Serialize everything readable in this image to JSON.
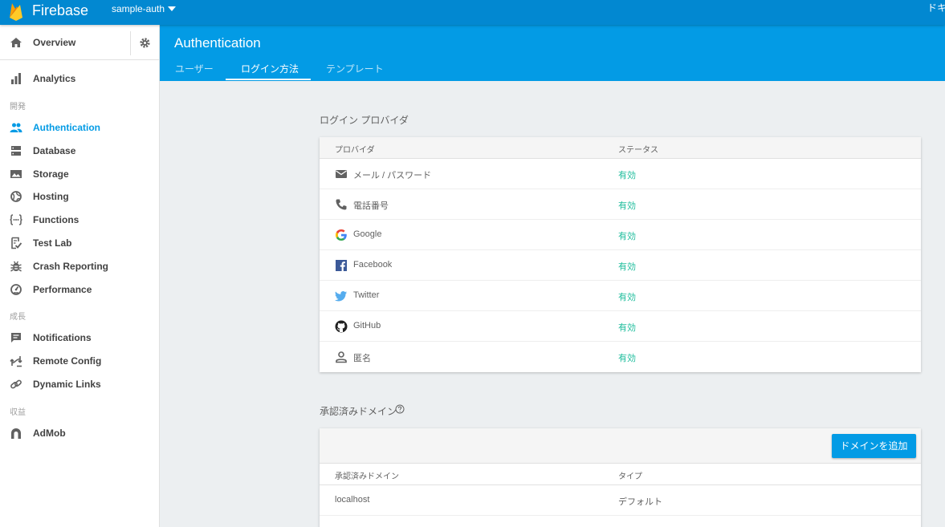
{
  "topbar": {
    "brand": "Firebase",
    "project": "sample-auth",
    "right_text": "ドキ"
  },
  "sidebar": {
    "overview": "Overview",
    "analytics": "Analytics",
    "section_develop": "開発",
    "develop_items": [
      {
        "label": "Authentication",
        "icon": "people-icon"
      },
      {
        "label": "Database",
        "icon": "database-icon"
      },
      {
        "label": "Storage",
        "icon": "image-icon"
      },
      {
        "label": "Hosting",
        "icon": "globe-icon"
      },
      {
        "label": "Functions",
        "icon": "functions-icon"
      },
      {
        "label": "Test Lab",
        "icon": "checklist-icon"
      },
      {
        "label": "Crash Reporting",
        "icon": "bug-icon"
      },
      {
        "label": "Performance",
        "icon": "gauge-icon"
      }
    ],
    "section_grow": "成長",
    "grow_items": [
      {
        "label": "Notifications",
        "icon": "message-icon"
      },
      {
        "label": "Remote Config",
        "icon": "remote-config-icon"
      },
      {
        "label": "Dynamic Links",
        "icon": "link-icon"
      }
    ],
    "section_earn": "収益",
    "earn_items": [
      {
        "label": "AdMob",
        "icon": "admob-icon"
      }
    ]
  },
  "header": {
    "title": "Authentication",
    "tabs": [
      "ユーザー",
      "ログイン方法",
      "テンプレート"
    ],
    "active_tab": 1
  },
  "providers": {
    "section_title": "ログイン プロバイダ",
    "col_provider": "プロバイダ",
    "col_status": "ステータス",
    "rows": [
      {
        "name": "メール / パスワード",
        "status": "有効",
        "icon": "mail-icon"
      },
      {
        "name": "電話番号",
        "status": "有効",
        "icon": "phone-icon"
      },
      {
        "name": "Google",
        "status": "有効",
        "icon": "google-icon"
      },
      {
        "name": "Facebook",
        "status": "有効",
        "icon": "facebook-icon"
      },
      {
        "name": "Twitter",
        "status": "有効",
        "icon": "twitter-icon"
      },
      {
        "name": "GitHub",
        "status": "有効",
        "icon": "github-icon"
      },
      {
        "name": "匿名",
        "status": "有効",
        "icon": "person-icon"
      }
    ]
  },
  "domains": {
    "section_title": "承認済みドメイン",
    "add_button": "ドメインを追加",
    "col_domain": "承認済みドメイン",
    "col_type": "タイプ",
    "rows": [
      {
        "domain": "localhost",
        "type": "デフォルト"
      }
    ]
  },
  "colors": {
    "topbar": "#0288d1",
    "header": "#039be5",
    "accent": "#039be5",
    "enabled": "#1bbc9b"
  }
}
